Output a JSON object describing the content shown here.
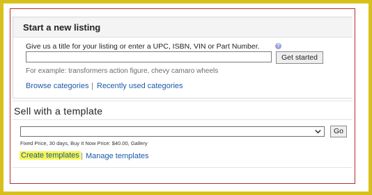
{
  "listing": {
    "title": "Start a new listing",
    "prompt": "Give us a title for your listing or enter a UPC, ISBN, VIN or Part Number.",
    "help_icon": "help-icon",
    "input_value": "",
    "get_started_label": "Get started",
    "example_text": "For example: transformers action figure, chevy camaro wheels",
    "browse_label": "Browse categories",
    "separator": "|",
    "recent_label": "Recently used categories"
  },
  "template": {
    "title": "Sell with a template",
    "selected_value": "",
    "go_label": "Go",
    "description": "Fixed Price, 30 days, Buy It Now Price: $40.00, Gallery",
    "create_label": "Create templates",
    "separator": "|",
    "manage_label": "Manage templates"
  },
  "colors": {
    "frame": "#d8c01a",
    "border_red": "#b62a2a",
    "link": "#1a5aa6",
    "highlight": "#f6f64a"
  }
}
